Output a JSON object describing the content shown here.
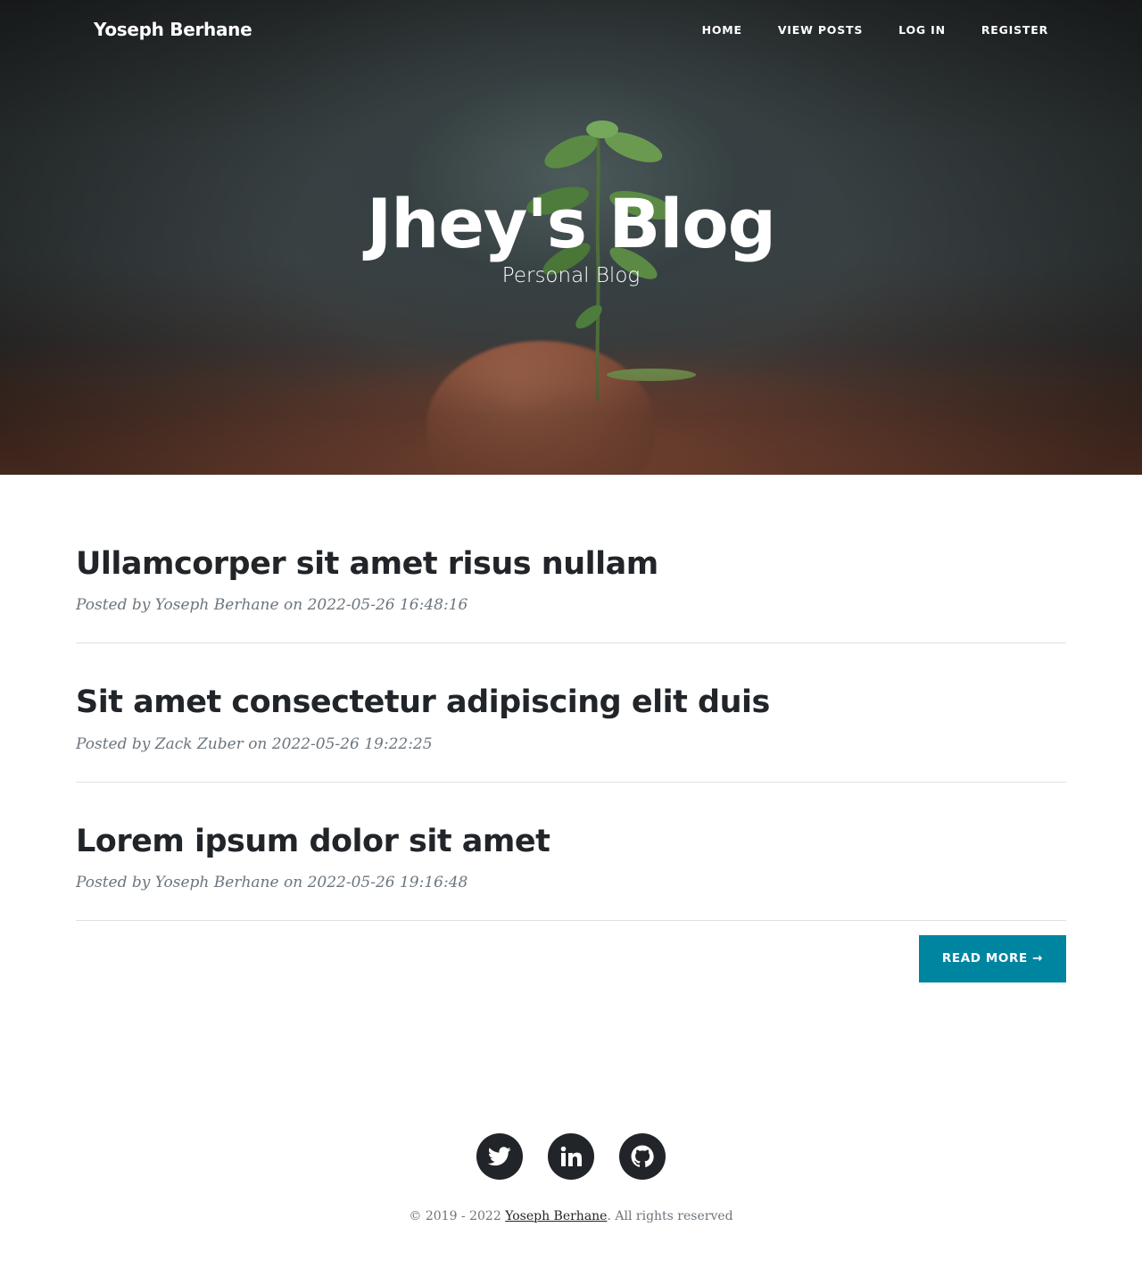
{
  "nav": {
    "brand": "Yoseph Berhane",
    "links": [
      "Home",
      "View Posts",
      "Log In",
      "Register"
    ]
  },
  "hero": {
    "title": "Jhey's Blog",
    "subtitle": "Personal Blog"
  },
  "posts": [
    {
      "title": "Ullamcorper sit amet risus nullam",
      "meta_prefix": "Posted by ",
      "author": "Yoseph Berhane",
      "meta_on": " on ",
      "date": "2022-05-26 16:48:16"
    },
    {
      "title": "Sit amet consectetur adipiscing elit duis",
      "meta_prefix": "Posted by ",
      "author": "Zack Zuber",
      "meta_on": " on ",
      "date": "2022-05-26 19:22:25"
    },
    {
      "title": "Lorem ipsum dolor sit amet",
      "meta_prefix": "Posted by ",
      "author": "Yoseph Berhane",
      "meta_on": " on ",
      "date": "2022-05-26 19:16:48"
    }
  ],
  "pager": {
    "read_more": "Read More →"
  },
  "footer": {
    "socials": [
      "twitter-icon",
      "linkedin-icon",
      "github-icon"
    ],
    "copyright_prefix": "© 2019 - 2022 ",
    "copyright_link": "Yoseph Berhane",
    "copyright_suffix": ". All rights reserved"
  },
  "colors": {
    "accent": "#0085a1",
    "heading": "#212529",
    "meta": "#6c757d",
    "divider": "#dee2e6"
  }
}
